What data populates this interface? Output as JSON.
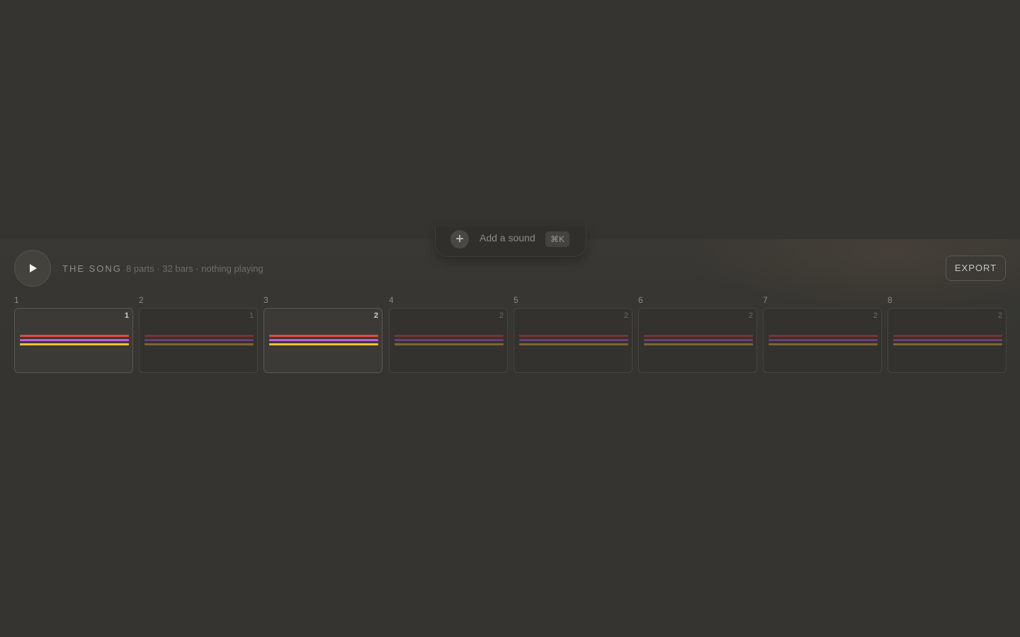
{
  "add_sound": {
    "icon": "plus-icon",
    "label": "Add a sound",
    "shortcut": "⌘K"
  },
  "song": {
    "play_icon": "play-icon",
    "title": "THE SONG",
    "meta": "8 parts · 32 bars · nothing playing",
    "export_label": "EXPORT"
  },
  "colors": {
    "track_red": "#e8493d",
    "track_purple": "#c25ae0",
    "track_yellow": "#f2c12e",
    "track_red_dim": "#7a3432",
    "track_purple_dim": "#6f3c78",
    "track_yellow_dim": "#7d6630"
  },
  "parts": [
    {
      "number": "1",
      "bars": "1",
      "active": true
    },
    {
      "number": "2",
      "bars": "1",
      "active": false
    },
    {
      "number": "3",
      "bars": "2",
      "active": true
    },
    {
      "number": "4",
      "bars": "2",
      "active": false
    },
    {
      "number": "5",
      "bars": "2",
      "active": false
    },
    {
      "number": "6",
      "bars": "2",
      "active": false
    },
    {
      "number": "7",
      "bars": "2",
      "active": false
    },
    {
      "number": "8",
      "bars": "2",
      "active": false
    }
  ]
}
